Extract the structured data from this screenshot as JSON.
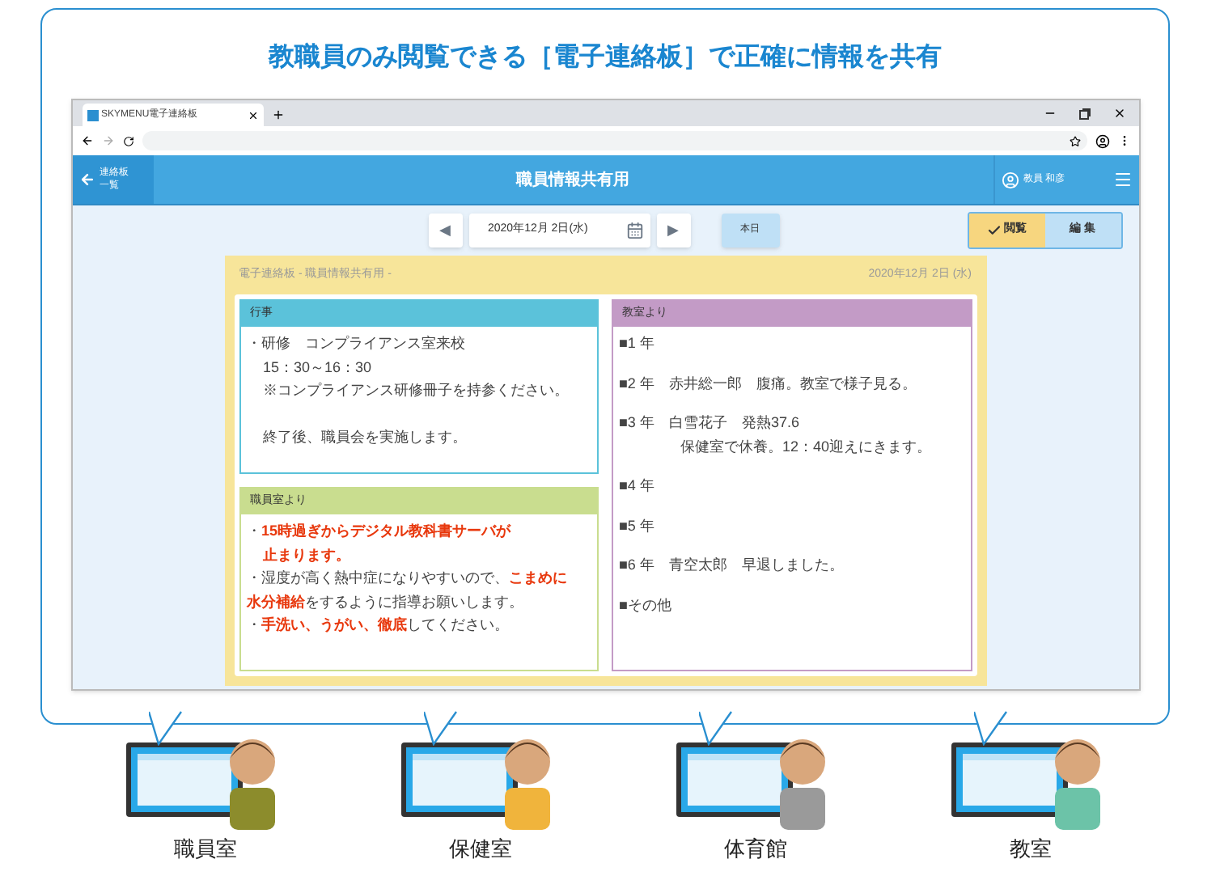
{
  "headline": "教職員のみ閲覧できる［電子連絡板］で正確に情報を共有",
  "browser": {
    "tab_title": "SKYMENU電子連絡板"
  },
  "app_header": {
    "back_label": [
      "連絡板",
      "一覧"
    ],
    "title": "職員情報共有用",
    "user": "教員 和彦"
  },
  "date_nav": {
    "previous_button": "◀",
    "date": "2020年12月 2日(水)",
    "next_button": "▶",
    "today_button": "本日"
  },
  "mode_tabs": [
    {
      "label": "閲覧",
      "selected": true
    },
    {
      "label": "編 集",
      "selected": false
    }
  ],
  "board": {
    "title": "電子連絡板 - 職員情報共有用 -",
    "date": "2020年12月 2日 (水)",
    "columns": [
      [
        {
          "title": "行事",
          "color": "#5bc2da",
          "paragraphs": [
            {
              "kind": "bullet",
              "text": "・研修　コンプライアンス室来校"
            },
            {
              "kind": "continued",
              "text": "15：30～16：30"
            },
            {
              "kind": "continued",
              "text": "※コンプライアンス研修冊子を持参ください。"
            },
            {
              "kind": "gap"
            },
            {
              "kind": "continued",
              "text": "終了後、職員会を実施します。"
            }
          ]
        },
        {
          "title": "職員室より",
          "color": "#c9dd8f",
          "paragraphs": [
            {
              "kind": "bullet",
              "text": "・**15時過ぎからデジタル教科書サーバが**"
            },
            {
              "kind": "continued",
              "text": "**止まります。**"
            },
            {
              "kind": "bullet",
              "text": "・湿度が高く熱中症になりやすいので、**こまめに**"
            },
            {
              "kind": "continued-flush",
              "text": "**水分補給**をするように指導お願いします。"
            },
            {
              "kind": "bullet",
              "text": "・**手洗い、うがい、徹底**してください。"
            }
          ]
        }
      ],
      [
        {
          "title": "教室より",
          "color": "#c39bc6",
          "paragraphs": [
            {
              "kind": "entry",
              "text": "■1 年"
            },
            {
              "kind": "entry",
              "text": "■2 年　赤井総一郎　腹痛。教室で様子見る。"
            },
            {
              "kind": "entry",
              "text": "■3 年　白雪花子　発熱37.6"
            },
            {
              "kind": "sub",
              "text": "保健室で休養。12：40迎えにきます。"
            },
            {
              "kind": "entry",
              "text": "■4 年"
            },
            {
              "kind": "entry",
              "text": "■5 年"
            },
            {
              "kind": "entry",
              "text": "■6 年　青空太郎　早退しました。"
            },
            {
              "kind": "entry",
              "text": "■その他"
            }
          ]
        }
      ]
    ]
  },
  "stations": [
    {
      "label": "職員室",
      "color": "#8c8c2c"
    },
    {
      "label": "保健室",
      "color": "#f0b43c"
    },
    {
      "label": "体育館",
      "color": "#9a9a9a"
    },
    {
      "label": "教室",
      "color": "#6cc3a8"
    }
  ]
}
